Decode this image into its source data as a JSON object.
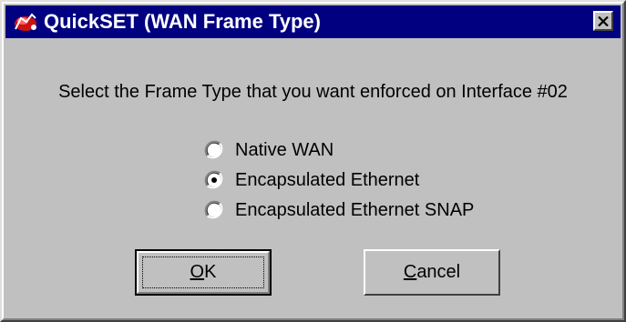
{
  "window": {
    "title": "QuickSET (WAN Frame Type)",
    "app_icon": "quickset-app-icon",
    "close_icon": "close-icon",
    "title_bar_color": "#000080",
    "face_color": "#c0c0c0"
  },
  "prompt": "Select the Frame Type that you want enforced on Interface #02",
  "options": [
    {
      "label": "Native WAN",
      "selected": false
    },
    {
      "label": "Encapsulated Ethernet",
      "selected": true
    },
    {
      "label": "Encapsulated Ethernet SNAP",
      "selected": false
    }
  ],
  "buttons": {
    "ok": {
      "accel": "O",
      "rest": "K",
      "label": "OK",
      "default": true
    },
    "cancel": {
      "accel": "C",
      "rest": "ancel",
      "label": "Cancel"
    }
  }
}
